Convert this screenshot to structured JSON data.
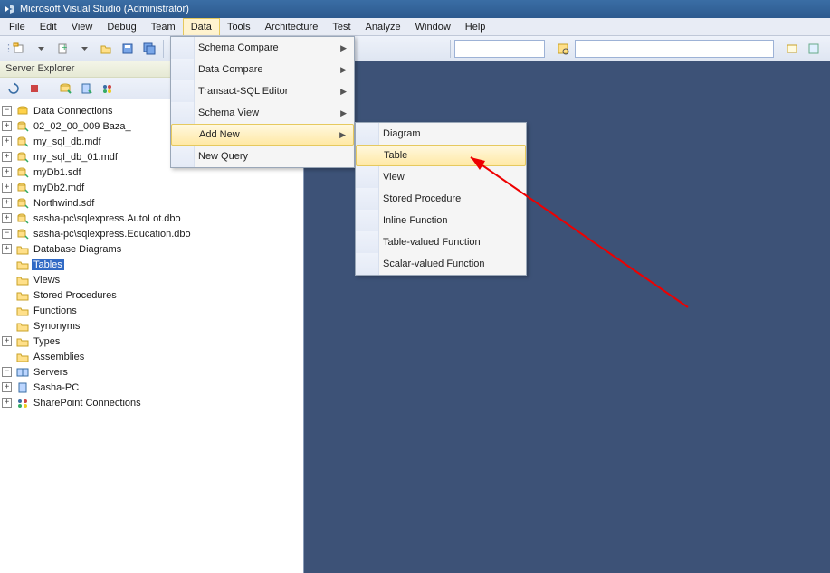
{
  "window": {
    "title": "Microsoft Visual Studio (Administrator)"
  },
  "menubar": {
    "items": [
      {
        "label": "File"
      },
      {
        "label": "Edit"
      },
      {
        "label": "View"
      },
      {
        "label": "Debug"
      },
      {
        "label": "Team"
      },
      {
        "label": "Data"
      },
      {
        "label": "Tools"
      },
      {
        "label": "Architecture"
      },
      {
        "label": "Test"
      },
      {
        "label": "Analyze"
      },
      {
        "label": "Window"
      },
      {
        "label": "Help"
      }
    ],
    "active_index": 5
  },
  "data_menu": {
    "items": [
      {
        "label": "Schema Compare",
        "submenu": true
      },
      {
        "label": "Data Compare",
        "submenu": true
      },
      {
        "label": "Transact-SQL Editor",
        "submenu": true
      },
      {
        "label": "Schema View",
        "submenu": true
      },
      {
        "label": "Add New",
        "submenu": true,
        "highlight": true
      },
      {
        "label": "New Query",
        "submenu": false
      }
    ]
  },
  "add_new_submenu": {
    "items": [
      {
        "label": "Diagram"
      },
      {
        "label": "Table",
        "highlight": true
      },
      {
        "label": "View"
      },
      {
        "label": "Stored Procedure"
      },
      {
        "label": "Inline Function"
      },
      {
        "label": "Table-valued Function"
      },
      {
        "label": "Scalar-valued Function"
      }
    ]
  },
  "server_explorer": {
    "title": "Server Explorer",
    "nodes": {
      "data_connections": "Data Connections",
      "db0": "02_02_00_009 Baza_",
      "db1": "my_sql_db.mdf",
      "db2": "my_sql_db_01.mdf",
      "db3": "myDb1.sdf",
      "db4": "myDb2.mdf",
      "db5": "Northwind.sdf",
      "db6": "sasha-pc\\sqlexpress.AutoLot.dbo",
      "db7": "sasha-pc\\sqlexpress.Education.dbo",
      "dbdiagrams": "Database Diagrams",
      "tables": "Tables",
      "views": "Views",
      "sprocs": "Stored Procedures",
      "functions": "Functions",
      "synonyms": "Synonyms",
      "types": "Types",
      "assemblies": "Assemblies",
      "servers": "Servers",
      "server0": "Sasha-PC",
      "sharepoint": "SharePoint Connections"
    }
  }
}
